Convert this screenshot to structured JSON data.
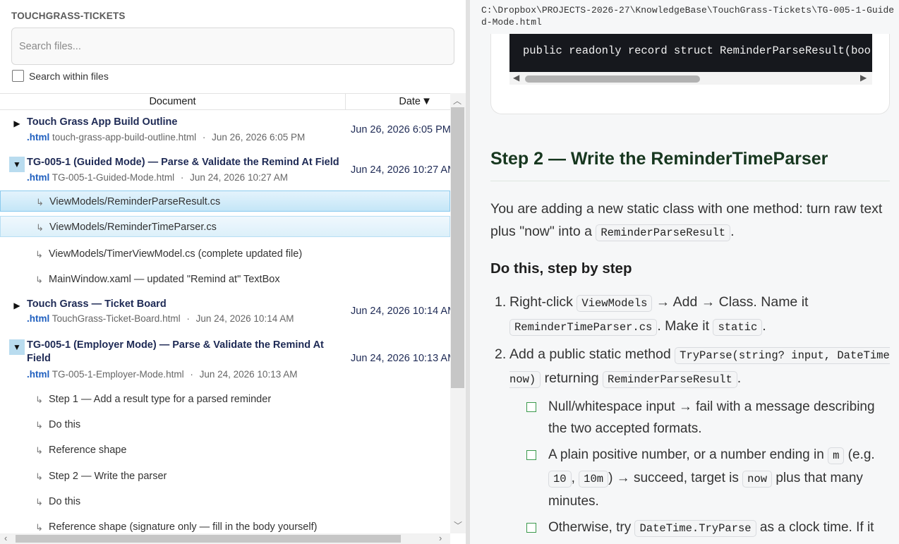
{
  "left_pane": {
    "title": "TOUCHGRASS-TICKETS",
    "search": {
      "placeholder": "Search files...",
      "value": ""
    },
    "search_within_files": {
      "label": "Search within files",
      "checked": false
    },
    "columns": {
      "document": "Document",
      "date": "Date",
      "sort_indicator": "▼"
    },
    "documents": [
      {
        "title": "Touch Grass App Build Outline",
        "ext": ".html",
        "filename": "touch-grass-app-build-outline.html",
        "modified": "Jun 26, 2026 6:05 PM",
        "date": "Jun 26, 2026 6:05 PM",
        "expanded": false,
        "toggle": "▶"
      },
      {
        "title": "TG-005-1 (Guided Mode) — Parse & Validate the Remind At Field",
        "ext": ".html",
        "filename": "TG-005-1-Guided-Mode.html",
        "modified": "Jun 24, 2026 10:27 AM",
        "date": "Jun 24, 2026 10:27 AM",
        "expanded": true,
        "toggle": "▼",
        "children": [
          "ViewModels/ReminderParseResult.cs",
          "ViewModels/ReminderTimeParser.cs",
          "ViewModels/TimerViewModel.cs (complete updated file)",
          "MainWindow.xaml — updated \"Remind at\" TextBox"
        ]
      },
      {
        "title": "Touch Grass — Ticket Board",
        "ext": ".html",
        "filename": "TouchGrass-Ticket-Board.html",
        "modified": "Jun 24, 2026 10:14 AM",
        "date": "Jun 24, 2026 10:14 AM",
        "expanded": false,
        "toggle": "▶"
      },
      {
        "title": "TG-005-1 (Employer Mode) — Parse & Validate the Remind At Field",
        "ext": ".html",
        "filename": "TG-005-1-Employer-Mode.html",
        "modified": "Jun 24, 2026 10:13 AM",
        "date": "Jun 24, 2026 10:13 AM",
        "expanded": true,
        "toggle": "▼",
        "children": [
          "Step 1 — Add a result type for a parsed reminder",
          "Do this",
          "Reference shape",
          "Step 2 — Write the parser",
          "Do this",
          "Reference shape (signature only — fill in the body yourself)"
        ]
      }
    ],
    "child_arrow": "↳",
    "scroll": {
      "up": "︿",
      "down": "﹀",
      "left": "‹",
      "right": "›"
    }
  },
  "right_pane": {
    "path": "C:\\Dropbox\\PROJECTS-2026-27\\KnowledgeBase\\TouchGrass-Tickets\\TG-005-1-Guided-Mode.html",
    "code_line": "public readonly record struct ReminderParseResult(bool",
    "code_scroll": {
      "left": "◀",
      "right": "▶"
    },
    "heading": "Step 2 — Write the ReminderTimeParser",
    "intro": {
      "text": "You are adding a new static class with one method: turn raw text plus \"now\" into a ",
      "code": "ReminderParseResult",
      "end": "."
    },
    "subheading": "Do this, step by step",
    "steps": [
      {
        "num": "1.",
        "t1": "Right-click ",
        "c1": "ViewModels",
        "t2": " → Add → Class. Name it ",
        "c2": "ReminderTimeParser.cs",
        "t3": ". Make it ",
        "c3": "static",
        "t4": "."
      },
      {
        "num": "2.",
        "t1": "Add a public static method ",
        "c1": "TryParse(string? input, DateTime now)",
        "t2": " returning ",
        "c2": "ReminderParseResult",
        "t3": "."
      }
    ],
    "checklist": [
      {
        "text": "Null/whitespace input → fail with a message describing the two accepted formats."
      },
      {
        "t1": "A plain positive number, or a number ending in ",
        "c1": "m",
        "t2": " (e.g. ",
        "c2": "10",
        "t3": ", ",
        "c3": "10m",
        "t4": ") → succeed, target is ",
        "c4": "now",
        "t5": " plus that many minutes."
      },
      {
        "t1": "Otherwise, try ",
        "c1": "DateTime.TryParse",
        "t2": " as a clock time. If it"
      }
    ]
  }
}
